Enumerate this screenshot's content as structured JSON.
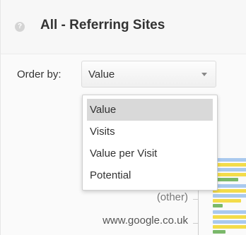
{
  "header": {
    "help_glyph": "?",
    "title": "All - Referring Sites"
  },
  "order": {
    "label": "Order by:",
    "selected": "Value",
    "options": [
      "Value",
      "Visits",
      "Value per Visit",
      "Potential"
    ]
  },
  "chart": {
    "rows": [
      {
        "label": "(other)"
      },
      {
        "label": "www.google.co.uk"
      }
    ],
    "colors": {
      "blue": "#a9c9ee",
      "yellow": "#f3dc4a",
      "green": "#7ab86a"
    }
  }
}
